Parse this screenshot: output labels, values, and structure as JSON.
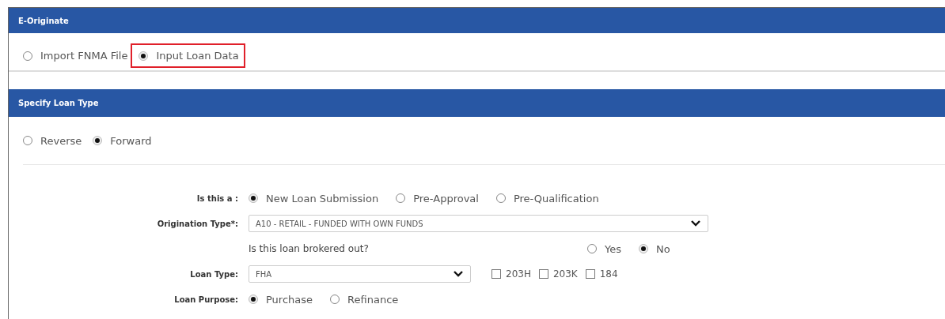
{
  "panels": [
    {
      "title": "E-Originate",
      "options": [
        {
          "label": "Import FNMA File",
          "selected": false,
          "highlighted": false
        },
        {
          "label": "Input Loan Data",
          "selected": true,
          "highlighted": true
        }
      ]
    },
    {
      "title": "Specify Loan Type",
      "options": [
        {
          "label": "Reverse",
          "selected": false,
          "highlighted": false
        },
        {
          "label": "Forward",
          "selected": true,
          "highlighted": false
        }
      ]
    }
  ],
  "form": {
    "rows": [
      {
        "kind": "radios",
        "label": "Is this a :",
        "options": [
          {
            "label": "New Loan Submission",
            "selected": true
          },
          {
            "label": "Pre-Approval",
            "selected": false
          },
          {
            "label": "Pre-Qualification",
            "selected": false
          }
        ]
      },
      {
        "kind": "select",
        "label": "Origination Type*:",
        "value": "A10 - RETAIL - FUNDED WITH OWN FUNDS"
      },
      {
        "kind": "question",
        "text": "Is this loan brokered out?",
        "options": [
          {
            "label": "Yes",
            "selected": false
          },
          {
            "label": "No",
            "selected": true
          }
        ]
      },
      {
        "kind": "select_checks",
        "label": "Loan Type:",
        "value": "FHA",
        "checks": [
          {
            "label": "203H",
            "checked": false
          },
          {
            "label": "203K",
            "checked": false
          },
          {
            "label": "184",
            "checked": false
          }
        ]
      },
      {
        "kind": "radios",
        "label": "Loan Purpose:",
        "options": [
          {
            "label": "Purchase",
            "selected": true
          },
          {
            "label": "Refinance",
            "selected": false
          }
        ]
      }
    ]
  }
}
